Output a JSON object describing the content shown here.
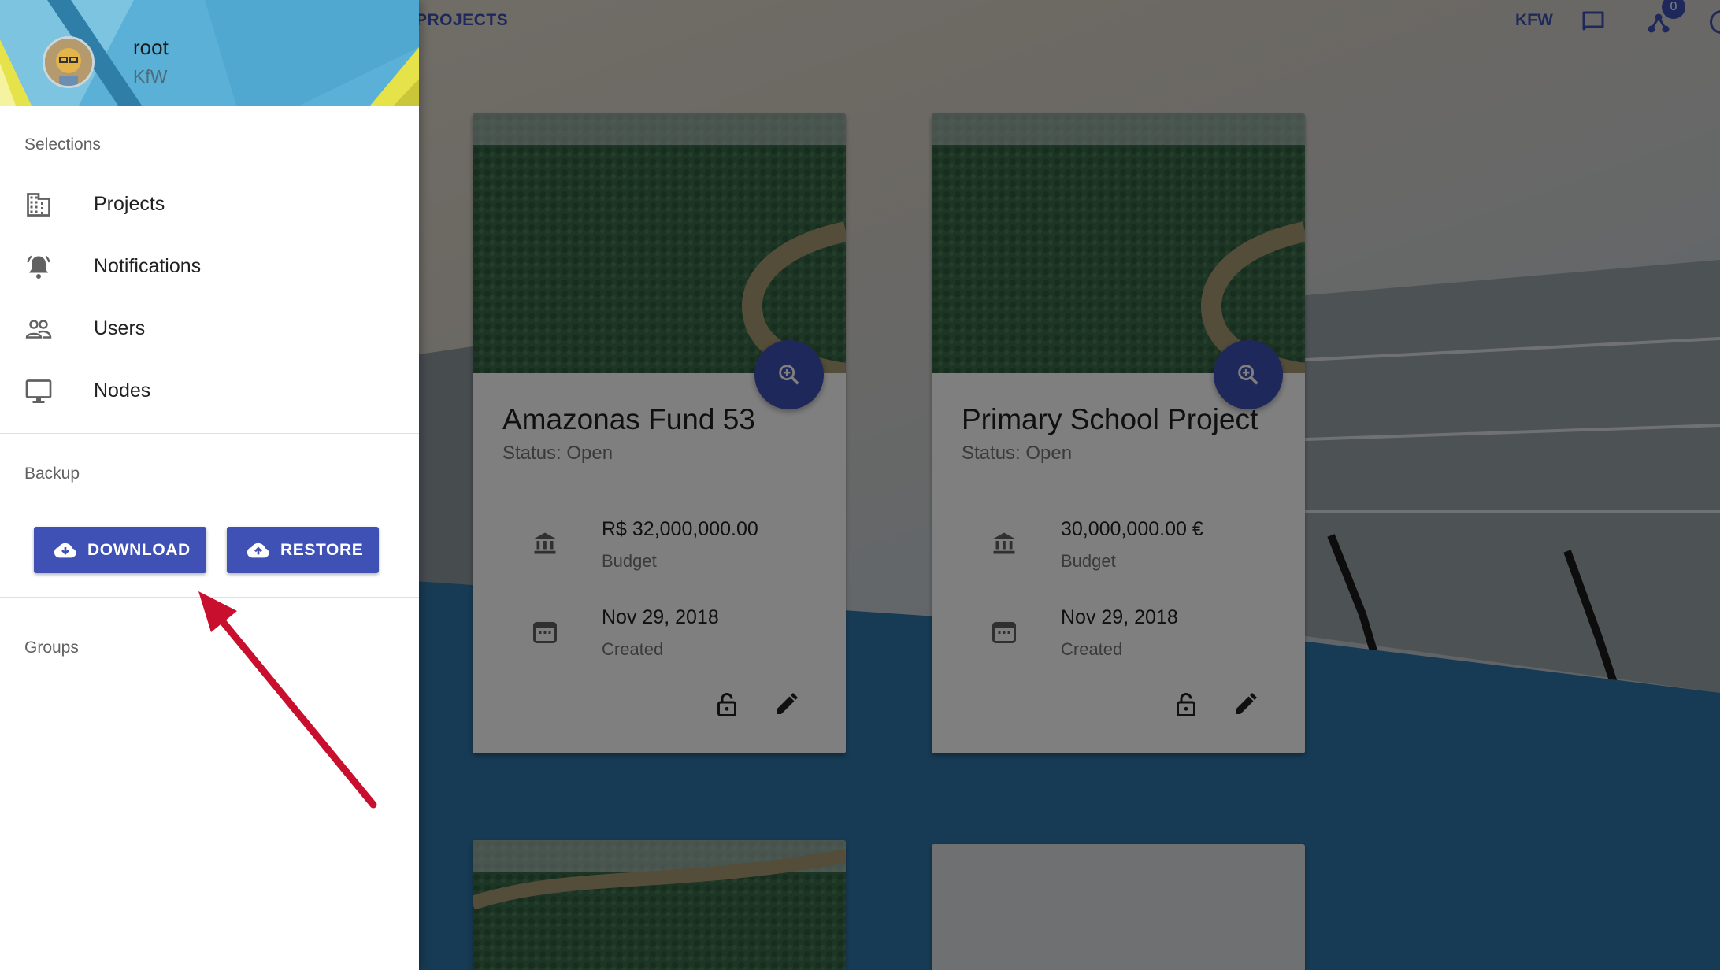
{
  "topbar": {
    "section_title": "PROJECTS",
    "org": "KFW",
    "notification_count": "0"
  },
  "drawer": {
    "user": {
      "name": "root",
      "org": "KfW"
    },
    "selections": {
      "heading": "Selections",
      "items": [
        {
          "label": "Projects",
          "icon": "business-icon"
        },
        {
          "label": "Notifications",
          "icon": "notifications-active-icon"
        },
        {
          "label": "Users",
          "icon": "people-icon"
        },
        {
          "label": "Nodes",
          "icon": "desktop-icon"
        }
      ]
    },
    "backup": {
      "heading": "Backup",
      "download_label": "DOWNLOAD",
      "restore_label": "RESTORE"
    },
    "groups": {
      "heading": "Groups"
    }
  },
  "projects": [
    {
      "title": "Amazonas Fund 53",
      "status": "Status: Open",
      "budget": "R$ 32,000,000.00",
      "budget_caption": "Budget",
      "created": "Nov 29, 2018",
      "created_caption": "Created"
    },
    {
      "title": "Primary School Project",
      "status": "Status: Open",
      "budget": "30,000,000.00 €",
      "budget_caption": "Budget",
      "created": "Nov 29, 2018",
      "created_caption": "Created"
    }
  ],
  "colors": {
    "primary": "#3f51b5",
    "annotation_arrow": "#c8102e",
    "header_teal": "#5ab0d6"
  }
}
